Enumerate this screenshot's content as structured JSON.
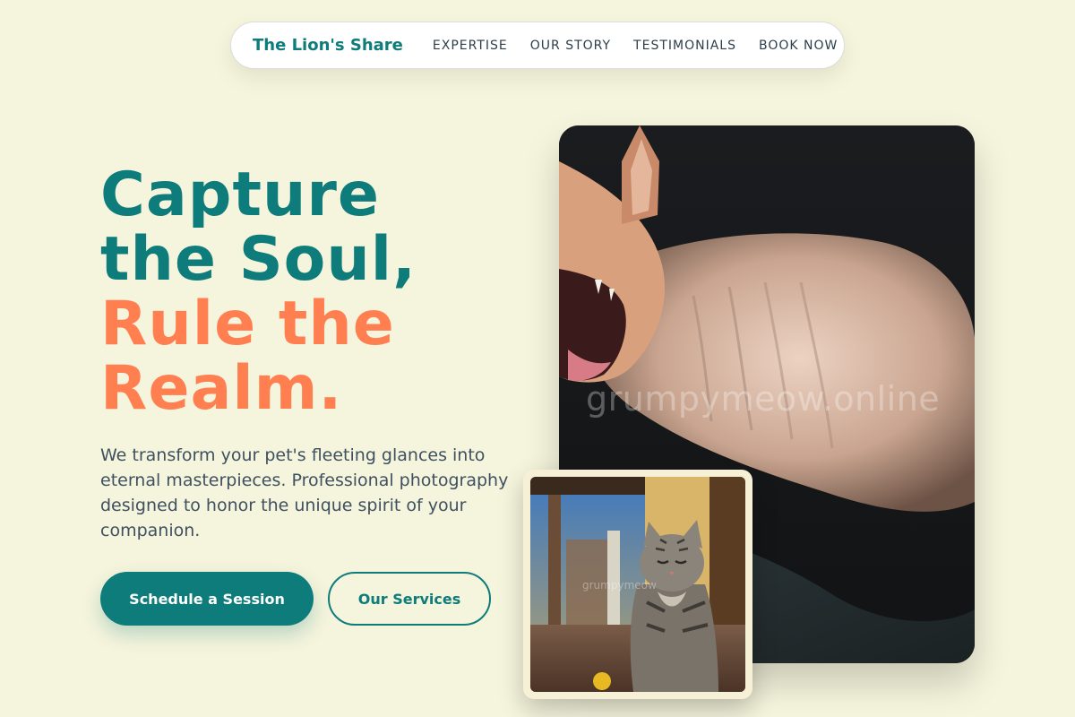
{
  "nav": {
    "brand": "The Lion's Share",
    "links": [
      "EXPERTISE",
      "OUR STORY",
      "TESTIMONIALS",
      "BOOK NOW"
    ]
  },
  "hero": {
    "headline_line1": "Capture",
    "headline_line2": "the Soul,",
    "headline_line3": "Rule the",
    "headline_line4": "Realm.",
    "subtext": "We transform your pet's fleeting glances into eternal masterpieces. Professional photography designed to honor the unique spirit of your companion.",
    "primary_button": "Schedule a Session",
    "secondary_button": "Our Services"
  },
  "photos": {
    "main_watermark": "grumpymeow.online",
    "small_watermark": "grumpymeow"
  },
  "colors": {
    "background": "#f5f4dc",
    "teal": "#0d7c7a",
    "coral": "#ff7f50",
    "body_text": "#3f5060"
  }
}
